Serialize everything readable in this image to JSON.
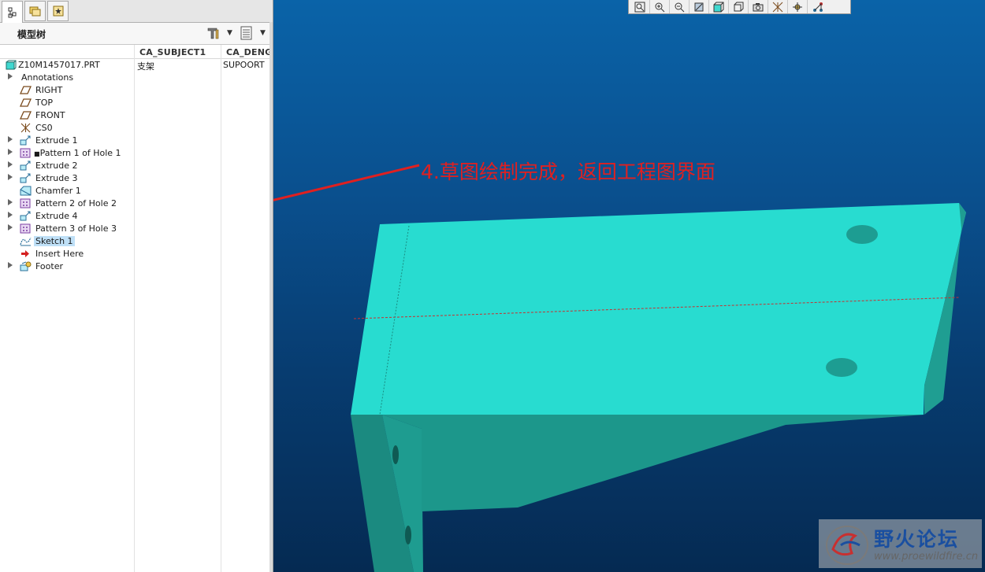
{
  "navigator": {
    "tabs": [
      {
        "icon": "model-tree-tab-icon"
      },
      {
        "icon": "folder-browser-tab-icon"
      },
      {
        "icon": "favorites-tab-icon"
      }
    ],
    "title": "模型树",
    "settings_icon": "tree-settings-icon",
    "columns_icon": "tree-columns-icon"
  },
  "columns": [
    "CA_SUBJECT1",
    "CA_DENG"
  ],
  "tree": {
    "root": {
      "label": "Z10M1457017.PRT",
      "col1": "支架",
      "col2": "SUPOORT"
    },
    "items": [
      {
        "label": "Annotations",
        "expandable": true,
        "icon": ""
      },
      {
        "label": "RIGHT",
        "expandable": false,
        "icon": "datum-plane-icon"
      },
      {
        "label": "TOP",
        "expandable": false,
        "icon": "datum-plane-icon"
      },
      {
        "label": "FRONT",
        "expandable": false,
        "icon": "datum-plane-icon"
      },
      {
        "label": "CS0",
        "expandable": false,
        "icon": "coordinate-system-icon"
      },
      {
        "label": "Extrude 1",
        "expandable": true,
        "icon": "extrude-icon"
      },
      {
        "label": "Pattern 1 of Hole 1",
        "expandable": true,
        "icon": "pattern-icon"
      },
      {
        "label": "Extrude 2",
        "expandable": true,
        "icon": "extrude-icon"
      },
      {
        "label": "Extrude 3",
        "expandable": true,
        "icon": "extrude-icon"
      },
      {
        "label": "Chamfer 1",
        "expandable": false,
        "icon": "chamfer-icon"
      },
      {
        "label": "Pattern 2 of Hole 2",
        "expandable": true,
        "icon": "pattern-icon"
      },
      {
        "label": "Extrude 4",
        "expandable": true,
        "icon": "extrude-icon"
      },
      {
        "label": "Pattern 3 of Hole 3",
        "expandable": true,
        "icon": "pattern-icon"
      },
      {
        "label": "Sketch 1",
        "expandable": false,
        "icon": "sketch-icon",
        "selected": true
      },
      {
        "label": "Insert Here",
        "expandable": false,
        "icon": "insert-here-arrow-icon"
      },
      {
        "label": "Footer",
        "expandable": true,
        "icon": "footer-icon"
      }
    ]
  },
  "view_toolbar": {
    "buttons": [
      "refit-icon",
      "zoom-in-icon",
      "zoom-out-icon",
      "repaint-icon",
      "display-style-icon",
      "saved-views-icon",
      "screenshot-icon",
      "datum-display-icon",
      "spin-center-icon",
      "appearance-icon"
    ]
  },
  "annotation": {
    "text": "4.草图绘制完成，返回工程图界面",
    "color": "#e02020"
  },
  "watermark": {
    "title": "野火论坛",
    "url": "www.proewildfire.cn"
  },
  "colors": {
    "viewport_top": "#0a63a8",
    "viewport_bottom": "#052a52",
    "part_face": "#28dcd0",
    "part_side": "#1a9488",
    "selection": "#bfe0f7"
  }
}
